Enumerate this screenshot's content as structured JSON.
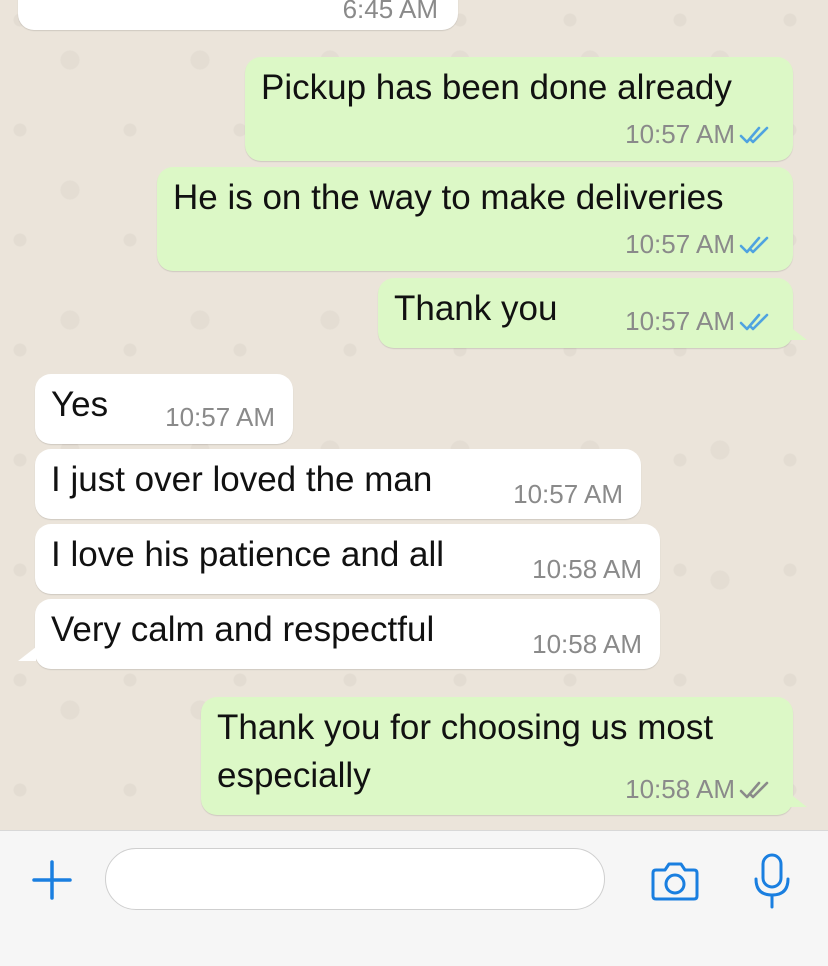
{
  "colors": {
    "outgoing_bubble": "#dcf8c6",
    "incoming_bubble": "#ffffff",
    "read_ticks": "#4fa3e0",
    "delivered_ticks": "#8a8a8a",
    "accent": "#1a7fe0"
  },
  "previous_message": {
    "time": "6:45 AM"
  },
  "messages": [
    {
      "direction": "outgoing",
      "text": "Pickup has been done already",
      "time": "10:57 AM",
      "status": "read"
    },
    {
      "direction": "outgoing",
      "text": "He is on the way to make deliveries",
      "time": "10:57 AM",
      "status": "read"
    },
    {
      "direction": "outgoing",
      "text": "Thank you",
      "time": "10:57 AM",
      "status": "read"
    },
    {
      "direction": "incoming",
      "text": "Yes",
      "time": "10:57 AM"
    },
    {
      "direction": "incoming",
      "text": "I just over loved the man",
      "time": "10:57 AM"
    },
    {
      "direction": "incoming",
      "text": "I love his patience and all",
      "time": "10:58 AM"
    },
    {
      "direction": "incoming",
      "text": "Very calm and respectful",
      "time": "10:58 AM"
    },
    {
      "direction": "outgoing",
      "text_line1": "Thank you for choosing us most",
      "text_line2": "especially",
      "time": "10:58 AM",
      "status": "delivered"
    }
  ],
  "input": {
    "value": "",
    "placeholder": ""
  },
  "icons": {
    "plus": "plus-icon",
    "camera": "camera-icon",
    "microphone": "microphone-icon",
    "read_receipt": "double-check-icon"
  }
}
